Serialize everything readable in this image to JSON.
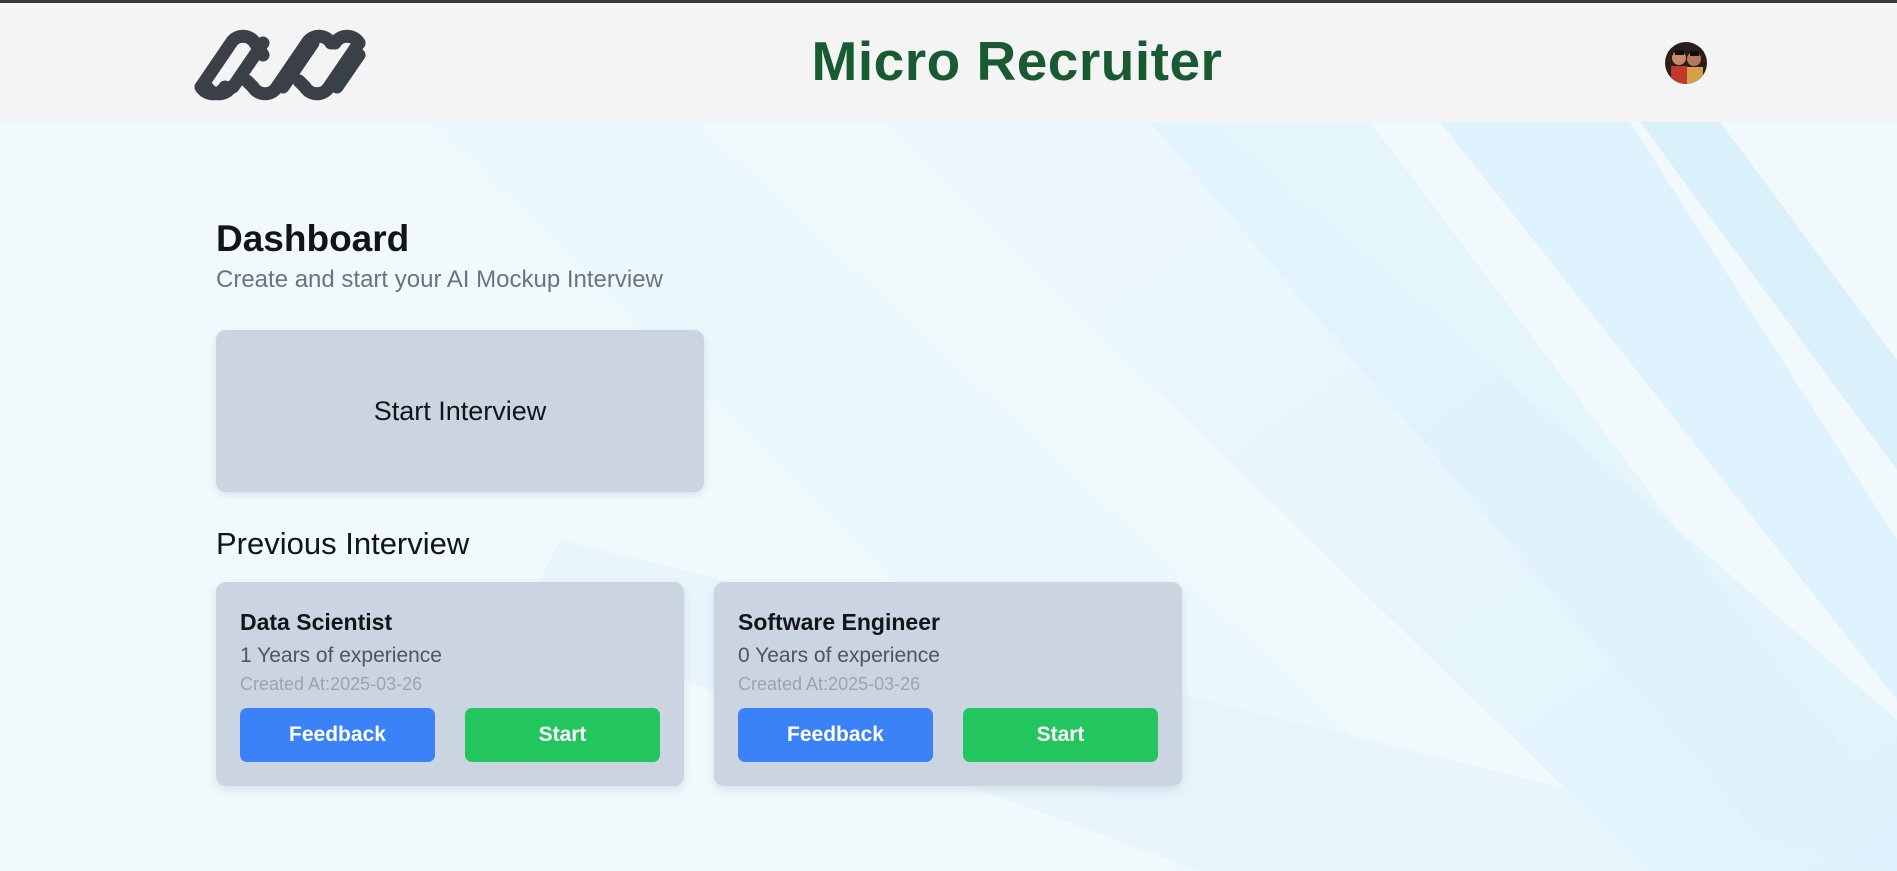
{
  "app": {
    "title": "Micro Recruiter",
    "brand_color": "#185a32",
    "logo_icon": "chain-link-logo-icon",
    "avatar_icon": "user-avatar-photo"
  },
  "dashboard": {
    "title": "Dashboard",
    "subtitle": "Create and start your AI Mockup Interview",
    "start_label": "Start Interview"
  },
  "previous": {
    "title": "Previous Interview",
    "items": [
      {
        "role": "Data Scientist",
        "experience": "1 Years of experience",
        "created": "Created At:2025-03-26",
        "feedback_label": "Feedback",
        "start_label": "Start"
      },
      {
        "role": "Software Engineer",
        "experience": "0 Years of experience",
        "created": "Created At:2025-03-26",
        "feedback_label": "Feedback",
        "start_label": "Start"
      }
    ]
  },
  "colors": {
    "feedback_button": "#3b82f6",
    "start_button": "#22c55e",
    "card_background": "#cbd5e1",
    "header_background": "#f4f4f4",
    "page_background": "#f1f9fd"
  }
}
